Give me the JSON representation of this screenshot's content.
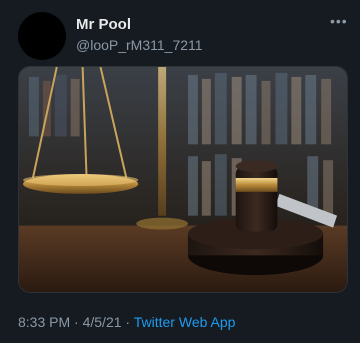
{
  "author": {
    "display_name": "Mr Pool",
    "handle": "@looP_rM311_7211"
  },
  "menu": {
    "icon": "more-dots-icon",
    "glyph": "•••"
  },
  "media": {
    "type": "photo",
    "subject": "scales-of-justice-and-gavel"
  },
  "meta": {
    "time": "8:33 PM",
    "separator1": "·",
    "date": "4/5/21",
    "separator2": "·",
    "source": "Twitter Web App"
  },
  "colors": {
    "background": "#161b22",
    "link": "#1d9bf0",
    "secondary_text": "#8b98a5"
  }
}
